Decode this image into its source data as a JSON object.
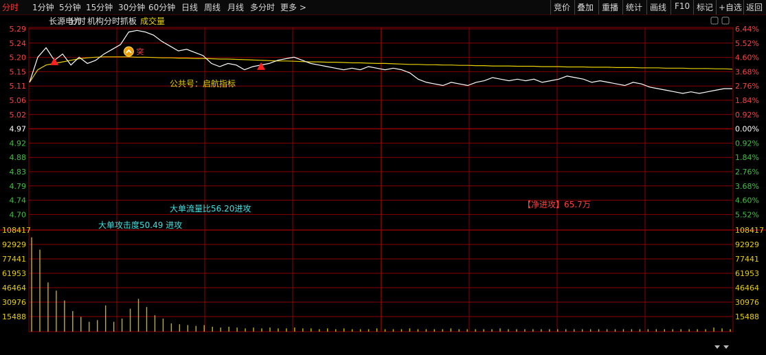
{
  "toolbar": {
    "tabs": [
      "分时",
      "1分钟",
      "5分钟",
      "15分钟",
      "30分钟",
      "60分钟",
      "日线",
      "周线",
      "月线",
      "多分时",
      "更多 >"
    ],
    "active": 0,
    "right": [
      "竞价",
      "叠加",
      "重播",
      "统计",
      "画线",
      "F10",
      "标记",
      "+自选",
      "返回"
    ]
  },
  "header": {
    "stock_name": "长源电力",
    "mode": "分时",
    "indicator": "机构分时抓板",
    "volume_label": "成交量"
  },
  "colors": {
    "background": "#000000",
    "grid": "#8b0000",
    "price_line": "#ffffff",
    "avg_line": "#e8d000",
    "volume_bar": "#c8b400",
    "up_text": "#ff4040",
    "down_text": "#40c040",
    "prev_close_text": "#ffffff",
    "cyan_text": "#40e0e0",
    "yellow_text": "#e8d000"
  },
  "chart_data": {
    "type": "line",
    "prev_close": 4.97,
    "price_ticks": [
      "5.29",
      "5.24",
      "5.20",
      "5.15",
      "5.11",
      "5.06",
      "5.02",
      "4.97",
      "4.92",
      "4.88",
      "4.83",
      "4.79",
      "4.74",
      "4.70"
    ],
    "percent_ticks": [
      "6.44%",
      "5.52%",
      "4.60%",
      "3.68%",
      "2.76%",
      "1.84%",
      "0.92%",
      "0.00%",
      "0.92%",
      "1.84%",
      "2.76%",
      "3.68%",
      "4.60%",
      "5.52%"
    ],
    "ylim": [
      4.6704,
      5.2897
    ],
    "volume_ticks": [
      "108417",
      "92929",
      "77441",
      "61953",
      "46464",
      "30976",
      "15488"
    ],
    "volume_ylim": [
      0,
      123905
    ],
    "price": [
      5.12,
      5.2,
      5.23,
      5.19,
      5.21,
      5.175,
      5.2,
      5.18,
      5.19,
      5.21,
      5.225,
      5.24,
      5.28,
      5.285,
      5.28,
      5.27,
      5.25,
      5.235,
      5.22,
      5.225,
      5.215,
      5.205,
      5.18,
      5.17,
      5.18,
      5.175,
      5.16,
      5.17,
      5.175,
      5.18,
      5.19,
      5.195,
      5.2,
      5.19,
      5.18,
      5.175,
      5.17,
      5.165,
      5.16,
      5.165,
      5.16,
      5.17,
      5.165,
      5.16,
      5.165,
      5.16,
      5.15,
      5.13,
      5.12,
      5.115,
      5.11,
      5.12,
      5.115,
      5.11,
      5.12,
      5.125,
      5.135,
      5.13,
      5.125,
      5.13,
      5.125,
      5.13,
      5.12,
      5.125,
      5.13,
      5.14,
      5.135,
      5.13,
      5.12,
      5.125,
      5.12,
      5.115,
      5.11,
      5.12,
      5.115,
      5.105,
      5.1,
      5.095,
      5.09,
      5.085,
      5.09,
      5.085,
      5.09,
      5.095,
      5.1,
      5.1
    ],
    "avg": [
      5.12,
      5.16,
      5.175,
      5.18,
      5.185,
      5.19,
      5.195,
      5.198,
      5.2,
      5.201,
      5.201,
      5.201,
      5.201,
      5.2,
      5.2,
      5.199,
      5.198,
      5.198,
      5.197,
      5.197,
      5.196,
      5.196,
      5.195,
      5.194,
      5.194,
      5.193,
      5.192,
      5.191,
      5.19,
      5.189,
      5.188,
      5.188,
      5.187,
      5.186,
      5.185,
      5.185,
      5.184,
      5.184,
      5.183,
      5.182,
      5.182,
      5.181,
      5.18,
      5.18,
      5.179,
      5.178,
      5.177,
      5.177,
      5.176,
      5.176,
      5.175,
      5.175,
      5.174,
      5.174,
      5.173,
      5.173,
      5.172,
      5.172,
      5.172,
      5.171,
      5.171,
      5.171,
      5.17,
      5.17,
      5.17,
      5.169,
      5.169,
      5.169,
      5.168,
      5.168,
      5.168,
      5.167,
      5.167,
      5.167,
      5.166,
      5.166,
      5.166,
      5.165,
      5.165,
      5.165,
      5.164,
      5.164,
      5.164,
      5.163,
      5.163,
      5.162
    ],
    "volume": [
      115000,
      100000,
      60000,
      50000,
      38000,
      25000,
      18000,
      12000,
      14000,
      32000,
      12000,
      16000,
      28000,
      40000,
      30000,
      20000,
      16000,
      10000,
      9000,
      8000,
      7000,
      8000,
      6000,
      5000,
      6000,
      5000,
      4000,
      5000,
      4000,
      5000,
      4000,
      4000,
      5000,
      4000,
      4000,
      3000,
      4000,
      3000,
      4000,
      3000,
      3000,
      3000,
      4000,
      3000,
      3000,
      3000,
      4000,
      3000,
      3000,
      3000,
      3000,
      4000,
      3000,
      3000,
      3000,
      3000,
      3000,
      4000,
      3000,
      3000,
      3000,
      3000,
      3000,
      3000,
      3000,
      3000,
      3000,
      3000,
      3000,
      3000,
      3000,
      3000,
      3000,
      3000,
      3000,
      3000,
      3000,
      3000,
      3000,
      3000,
      3000,
      3000,
      3000,
      5000,
      4000,
      3000
    ],
    "signals": [
      {
        "index": 3,
        "type": "buy-triangle"
      },
      {
        "index": 12,
        "type": "breakout-circle",
        "label": "突"
      },
      {
        "index": 28,
        "type": "buy-triangle"
      }
    ],
    "annotations": [
      {
        "text": "公共号：启航指标",
        "color": "yellow"
      },
      {
        "text": "大单流量比56.20进攻",
        "color": "cyan"
      },
      {
        "text": "大单攻击度50.49 进攻",
        "color": "cyan"
      },
      {
        "text": "【净进攻】65.7万",
        "color": "red"
      }
    ]
  }
}
